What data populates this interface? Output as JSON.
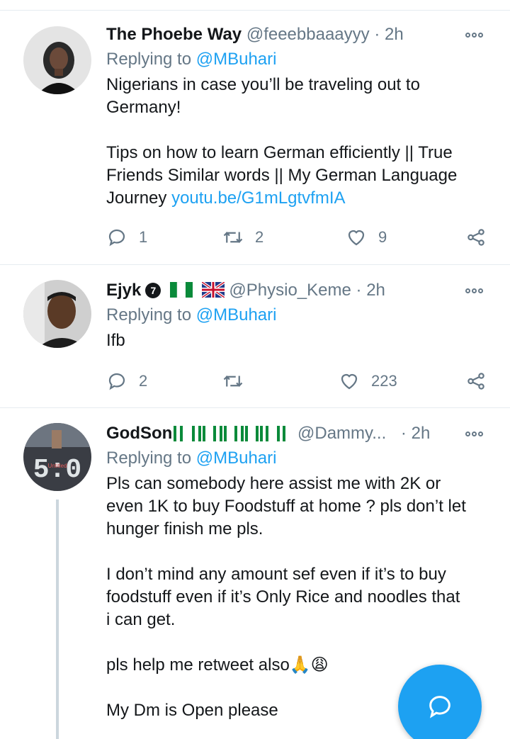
{
  "tweets": [
    {
      "name": "The Phoebe Way",
      "handle": "@feeebbaaayyy",
      "separator": "·",
      "time": "2h",
      "replying_prefix": "Replying to",
      "replying_to": "@MBuhari",
      "body_line1": "Nigerians in case you’ll be traveling out to",
      "body_line2": "Germany!",
      "body_line3": "Tips on how to learn German efficiently || True",
      "body_line4": "Friends Similar words || My German Language",
      "body_line5": "Journey",
      "link": "youtu.be/G1mLgtvfmIA",
      "replies": "1",
      "retweets": "2",
      "likes": "9",
      "avatar_icon": "woman-avatar"
    },
    {
      "name": "Ejyk",
      "badge": "7",
      "handle": "@Physio_Keme",
      "separator": "·",
      "time": "2h",
      "replying_prefix": "Replying to",
      "replying_to": "@MBuhari",
      "body_line1": "Ifb",
      "replies": "2",
      "retweets": "",
      "likes": "223",
      "avatar_icon": "man-avatar"
    },
    {
      "name": "GodSon",
      "handle": "@Dammy...",
      "separator": "·",
      "time": "2h",
      "replying_prefix": "Replying to",
      "replying_to": "@MBuhari",
      "body_line1": "Pls can somebody here assist me with 2K or",
      "body_line2": "even 1K to buy Foodstuff at home ? pls don’t let",
      "body_line3": "hunger finish me  pls.",
      "body_line4": "I don’t mind any amount sef even if it’s to buy",
      "body_line5": "foodstuff even if it’s Only Rice and noodles that",
      "body_line6": "i can get.",
      "body_line7": "pls help me retweet also",
      "body_line7_emoji": "🙏😩",
      "body_line8": "My Dm is Open please",
      "avatar_icon": "scoreboard-avatar"
    }
  ],
  "colors": {
    "accent": "#1da1f2",
    "secondary_text": "#657786",
    "divider": "#e6ecf0"
  },
  "fab": {
    "icon": "compose-reply-icon"
  }
}
